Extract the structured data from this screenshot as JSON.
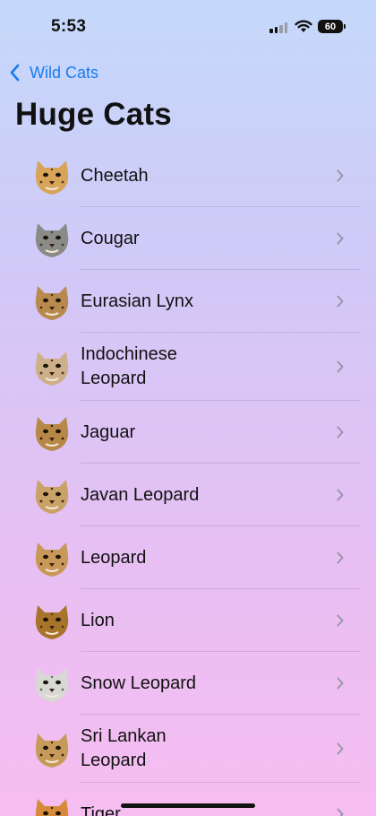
{
  "status": {
    "time": "5:53",
    "battery": "60"
  },
  "nav": {
    "back_label": "Wild Cats"
  },
  "page": {
    "title": "Huge Cats"
  },
  "items": [
    {
      "name": "Cheetah",
      "fur": "#d7a45a",
      "mark": "#5a3a1a"
    },
    {
      "name": "Cougar",
      "fur": "#8a8a86",
      "mark": "#3e3e3c"
    },
    {
      "name": "Eurasian Lynx",
      "fur": "#b98a50",
      "mark": "#4a3018"
    },
    {
      "name": "Indochinese\nLeopard",
      "fur": "#cdb08a",
      "mark": "#4a3520"
    },
    {
      "name": "Jaguar",
      "fur": "#b88848",
      "mark": "#2e1c0c"
    },
    {
      "name": "Javan Leopard",
      "fur": "#c9a268",
      "mark": "#3a2610"
    },
    {
      "name": "Leopard",
      "fur": "#c89858",
      "mark": "#3a2410"
    },
    {
      "name": "Lion",
      "fur": "#a8742c",
      "mark": "#5a3410"
    },
    {
      "name": "Snow Leopard",
      "fur": "#d8d8d4",
      "mark": "#6a6a68"
    },
    {
      "name": "Sri Lankan\nLeopard",
      "fur": "#c69a5a",
      "mark": "#3a2410"
    },
    {
      "name": "Tiger",
      "fur": "#d68a3a",
      "mark": "#2a1a0a"
    }
  ]
}
